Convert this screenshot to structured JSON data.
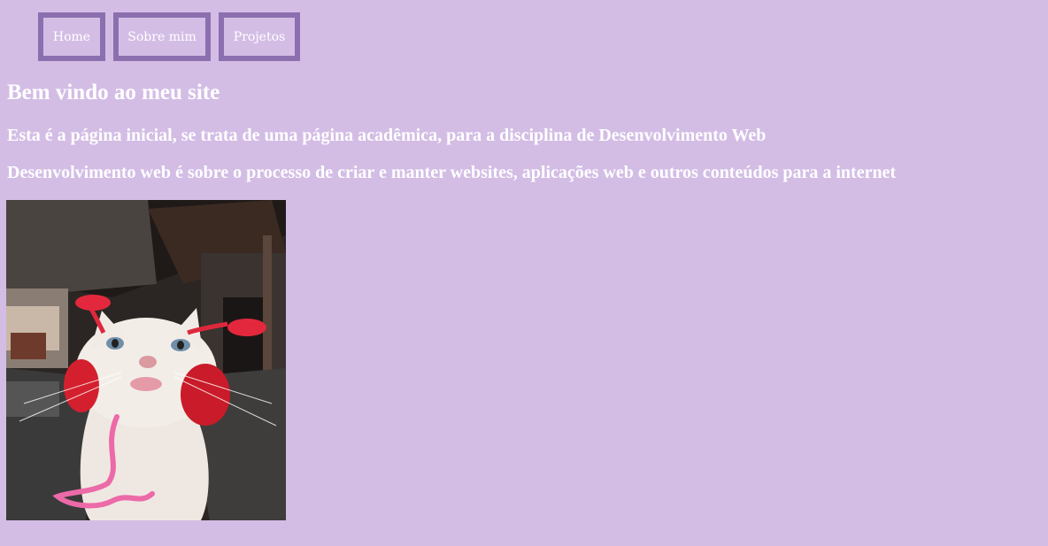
{
  "nav": {
    "items": [
      {
        "label": "Home"
      },
      {
        "label": "Sobre mim"
      },
      {
        "label": "Projetos"
      }
    ]
  },
  "main": {
    "heading": "Bem vindo ao meu site",
    "paragraphs": [
      "Esta é a página inicial, se trata de uma página acadêmica, para a disciplina de Desenvolvimento Web",
      "Desenvolvimento web é sobre o processo de criar e manter websites, aplicações web e outros conteúdos para a internet"
    ]
  },
  "colors": {
    "background": "#d3bde5",
    "nav_border": "#8c6fae",
    "text": "#ffffff"
  },
  "image": {
    "subject": "cat-with-red-antenna-headband"
  }
}
